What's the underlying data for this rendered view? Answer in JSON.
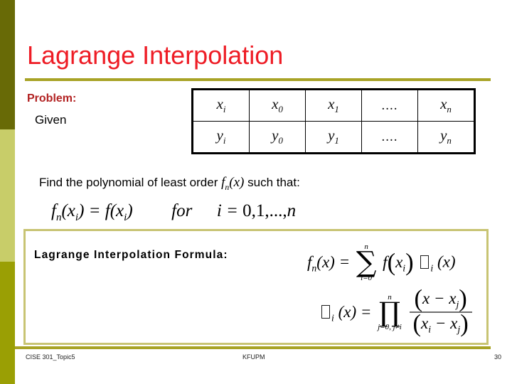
{
  "slide": {
    "title": "Lagrange Interpolation",
    "accent_color": "#a8a326",
    "title_color": "#ee1c25",
    "sidebar": {
      "top_color": "#686a06",
      "mid_color": "#c8cd69",
      "bottom_color": "#9a9f04"
    }
  },
  "problem": {
    "label": "Problem:",
    "given": "Given"
  },
  "data_table": {
    "rows": [
      {
        "cells": [
          "x_i",
          "x_0",
          "x_1",
          "....",
          "x_n"
        ]
      },
      {
        "cells": [
          "y_i",
          "y_0",
          "y_1",
          "....",
          "y_n"
        ]
      }
    ],
    "row0": {
      "c0": "x",
      "c0s": "i",
      "c1": "x",
      "c1s": "0",
      "c2": "x",
      "c2s": "1",
      "c3": "....",
      "c4": "x",
      "c4s": "n"
    },
    "row1": {
      "c0": "y",
      "c0s": "i",
      "c1": "y",
      "c1s": "0",
      "c2": "y",
      "c2s": "1",
      "c3": "....",
      "c4": "y",
      "c4s": "n"
    }
  },
  "find_line": {
    "before": "Find the polynomial of least order",
    "func_base": "f",
    "func_sub": "n",
    "func_arg": "(x)",
    "after": "such that:"
  },
  "condition": {
    "lhs_base": "f",
    "lhs_sub": "n",
    "lhs_arg_open": "(",
    "lhs_arg_var": "x",
    "lhs_arg_sub": "i",
    "lhs_arg_close": ")",
    "equals": "=",
    "rhs": "f",
    "rhs_arg_open": "(",
    "rhs_arg_var": "x",
    "rhs_arg_sub": "i",
    "rhs_arg_close": ")",
    "for_word": "for",
    "index_var": "i",
    "index_equals": "=",
    "index_values": "0,1,...,",
    "index_n": "n"
  },
  "formula": {
    "title": "Lagrange Interpolation Formula:",
    "border_color": "#c8c473",
    "eq1": {
      "lhs_base": "f",
      "lhs_sub": "n",
      "lhs_arg": "(x)",
      "equals": "=",
      "sum_upper": "n",
      "sum_glyph": "∑",
      "sum_lower": "i=0",
      "term_f": "f",
      "term_open": "(",
      "term_var": "x",
      "term_sub": "i",
      "term_close": ")",
      "lambda_sub": "i",
      "lambda_arg": "(x)"
    },
    "eq2": {
      "lambda_sub": "i",
      "lambda_arg": "(x)",
      "equals": "=",
      "prod_upper": "n",
      "prod_glyph": "∏",
      "prod_lower": "j=0, j≠i",
      "num_open": "(",
      "num_x": "x",
      "num_minus": "−",
      "num_xj": "x",
      "num_jsub": "j",
      "num_close": ")",
      "den_open": "(",
      "den_xi": "x",
      "den_isub": "i",
      "den_minus": "−",
      "den_xj": "x",
      "den_jsub": "j",
      "den_close": ")"
    }
  },
  "footer": {
    "left": "CISE 301_Topic5",
    "center": "KFUPM",
    "right": "30"
  }
}
